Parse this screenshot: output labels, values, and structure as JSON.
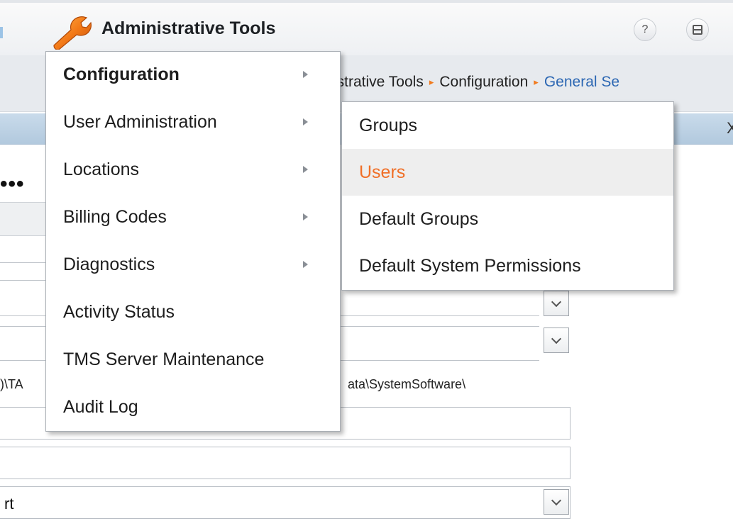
{
  "header": {
    "title": "Administrative Tools",
    "help_glyph": "?",
    "icons": [
      "wrench-icon",
      "help-icon",
      "window-icon"
    ]
  },
  "breadcrumb": {
    "items": [
      "istrative Tools",
      "Configuration",
      "General Se"
    ],
    "separator": "▸"
  },
  "panel": {
    "close_glyph": "X"
  },
  "background_form": {
    "password_dots": "•••",
    "path_left": ")\\TA",
    "path_right": "ata\\SystemSoftware\\",
    "bottom_select_value": "rt"
  },
  "menu": {
    "items": [
      {
        "label": "Configuration",
        "has_submenu": true,
        "active": true
      },
      {
        "label": "User Administration",
        "has_submenu": true
      },
      {
        "label": "Locations",
        "has_submenu": true
      },
      {
        "label": "Billing Codes",
        "has_submenu": true
      },
      {
        "label": "Diagnostics",
        "has_submenu": true
      },
      {
        "label": "Activity Status",
        "has_submenu": false
      },
      {
        "label": "TMS Server Maintenance",
        "has_submenu": false
      },
      {
        "label": "Audit Log",
        "has_submenu": false
      }
    ]
  },
  "submenu": {
    "parent": "User Administration",
    "items": [
      {
        "label": "Groups"
      },
      {
        "label": "Users",
        "hover": true
      },
      {
        "label": "Default Groups"
      },
      {
        "label": "Default System Permissions"
      }
    ]
  },
  "colors": {
    "accent_orange": "#f06f27",
    "breadcrumb_link": "#2c67b3",
    "panel_bar": "#b9cfe3",
    "menu_border": "#a9aeb4"
  }
}
